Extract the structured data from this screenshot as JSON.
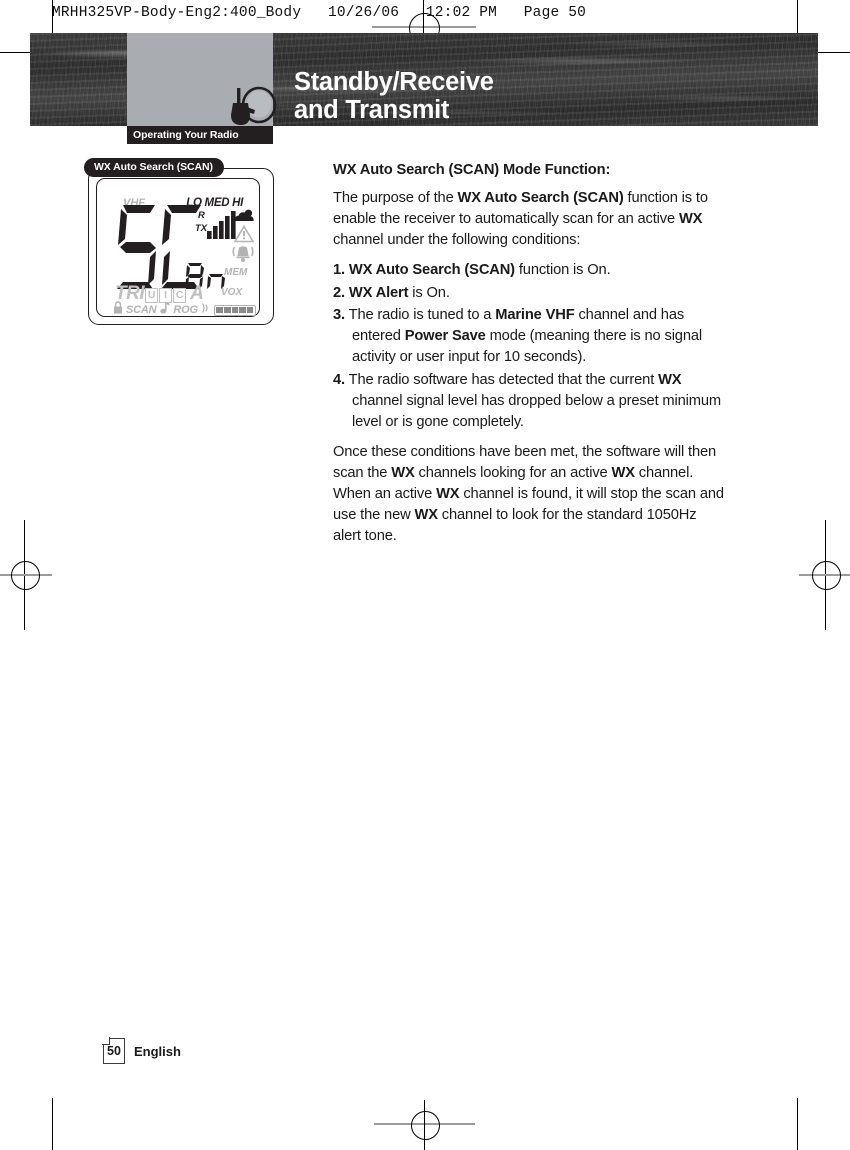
{
  "print_slug": "MRHH325VP-Body-Eng2:400_Body   10/26/06   12:02 PM   Page 50",
  "banner": {
    "title_line1": "Standby/Receive",
    "title_line2": "and Transmit",
    "section_tab": "Operating Your Radio",
    "icon": "radio-handset-icon"
  },
  "figure": {
    "callout": "WX Auto Search (SCAN)",
    "lcd": {
      "vhf": "VHF",
      "power_levels": "LO MED HI",
      "rx": "R",
      "tx": "TX",
      "main_digits": "SC",
      "sub_digits": "An",
      "mem": "MEM",
      "vox": "VOX",
      "tri": "TRI",
      "boxes": [
        "U",
        "I",
        "C"
      ],
      "letter_a": "A",
      "lock": "lock-icon",
      "scan": "SCAN",
      "note": "music-note-icon",
      "rog": "ROG",
      "rog_wave": "))",
      "battery_segments": 5,
      "cloud": "cloud-icon",
      "warning": "warning-triangle-icon",
      "bell": "bell-icon",
      "signal_bars": 5
    }
  },
  "content": {
    "heading": "WX Auto Search (SCAN) Mode Function:",
    "intro": {
      "p1": "The purpose of the ",
      "b1": "WX Auto Search (SCAN)",
      "p2": " function is to enable the receiver to automatically scan for an active ",
      "b2": "WX",
      "p3": " channel under the following conditions:"
    },
    "items": [
      {
        "num": "1.",
        "bold_lead": "WX Auto Search (SCAN)",
        "rest": " function is On."
      },
      {
        "num": "2.",
        "bold_lead": "WX Alert",
        "rest": " is On."
      },
      {
        "num": "3.",
        "text_a": "The radio is tuned to a ",
        "bold_a": "Marine VHF",
        "text_b": " channel and has entered ",
        "bold_b": "Power Save",
        "text_c": " mode (meaning there is no signal activity or user input for 10 seconds)."
      },
      {
        "num": "4.",
        "text_a": "The radio software has detected that the current ",
        "bold_a": "WX",
        "text_b": " channel signal level has dropped below a preset minimum level or is gone completely."
      }
    ],
    "closing": {
      "t1": "Once these conditions have been met, the software will then scan the ",
      "b1": "WX",
      "t2": " channels looking for an active ",
      "b2": "WX",
      "t3": " channel. When an active ",
      "b3": "WX",
      "t4": " channel is found, it will stop the scan and use the new ",
      "b4": "WX",
      "t5": " channel to look for the standard 1050Hz alert tone."
    }
  },
  "footer": {
    "page_number": "50",
    "language": "English"
  },
  "colors": {
    "ink": "#231f20",
    "banner_gray": "#a9adb2",
    "lcd_dim": "#b3b3b3"
  }
}
